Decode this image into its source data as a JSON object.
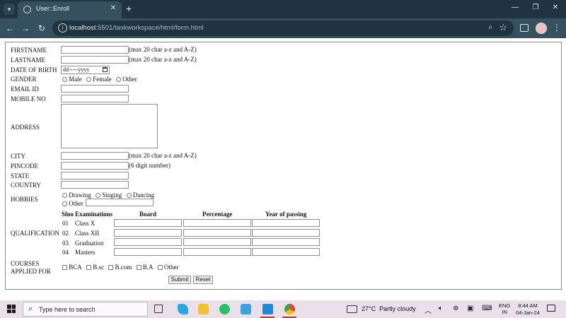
{
  "browser": {
    "tab_title": "User::Enroll",
    "url_host": "localhost",
    "url_path": ":5501/taskworkspace/html/form.html"
  },
  "form": {
    "labels": {
      "firstname": "FIRSTNAME",
      "lastname": "LASTNAME",
      "dob": "DATE OF BIRTH",
      "gender": "GENDER",
      "email": "EMAIL ID",
      "mobile": "MOBILE NO",
      "address": "ADDRESS",
      "city": "CITY",
      "pincode": "PINCODE",
      "state": "STATE",
      "country": "COUNTRY",
      "hobbies": "HOBBIES",
      "qualification": "QUALIFICATION",
      "courses_line1": "COURSES",
      "courses_line2": "APPLIED FOR"
    },
    "hints": {
      "firstname": "(max 20 char a-z and A-Z)",
      "lastname": "(max 20 char a-z and A-Z)",
      "city": "(max 20 char a-z and A-Z)",
      "pincode": "(6 digit number)"
    },
    "dob_placeholder": "dd-----yyyy",
    "gender_options": [
      "Male",
      "Female",
      "Other"
    ],
    "hobby_options": [
      "Drawing",
      "Singing",
      "Dancing"
    ],
    "hobby_other": "Other",
    "qualification_headers": {
      "slno": "Slno",
      "examinations": "Examinations",
      "board": "Board",
      "percentage": "Percentage",
      "year": "Year of passing"
    },
    "qualification_rows": [
      {
        "slno": "01",
        "exam": "Class X"
      },
      {
        "slno": "02",
        "exam": "Class XII"
      },
      {
        "slno": "03",
        "exam": "Graduation"
      },
      {
        "slno": "04",
        "exam": "Masters"
      }
    ],
    "course_options": [
      "BCA",
      "B.sc",
      "B.com",
      "B.A",
      "Other"
    ],
    "submit_label": "Submit",
    "reset_label": "Reset"
  },
  "taskbar": {
    "search_placeholder": "Type here to search",
    "weather_temp": "27°C",
    "weather_desc": "Partly cloudy",
    "lang_top": "ENG",
    "lang_bottom": "IN",
    "time": "8:44 AM",
    "date": "04-Jan-24"
  },
  "colors": {
    "tab_bar": "#1f3340",
    "toolbar": "#35515f",
    "taskbar": "#e9e0ea"
  }
}
